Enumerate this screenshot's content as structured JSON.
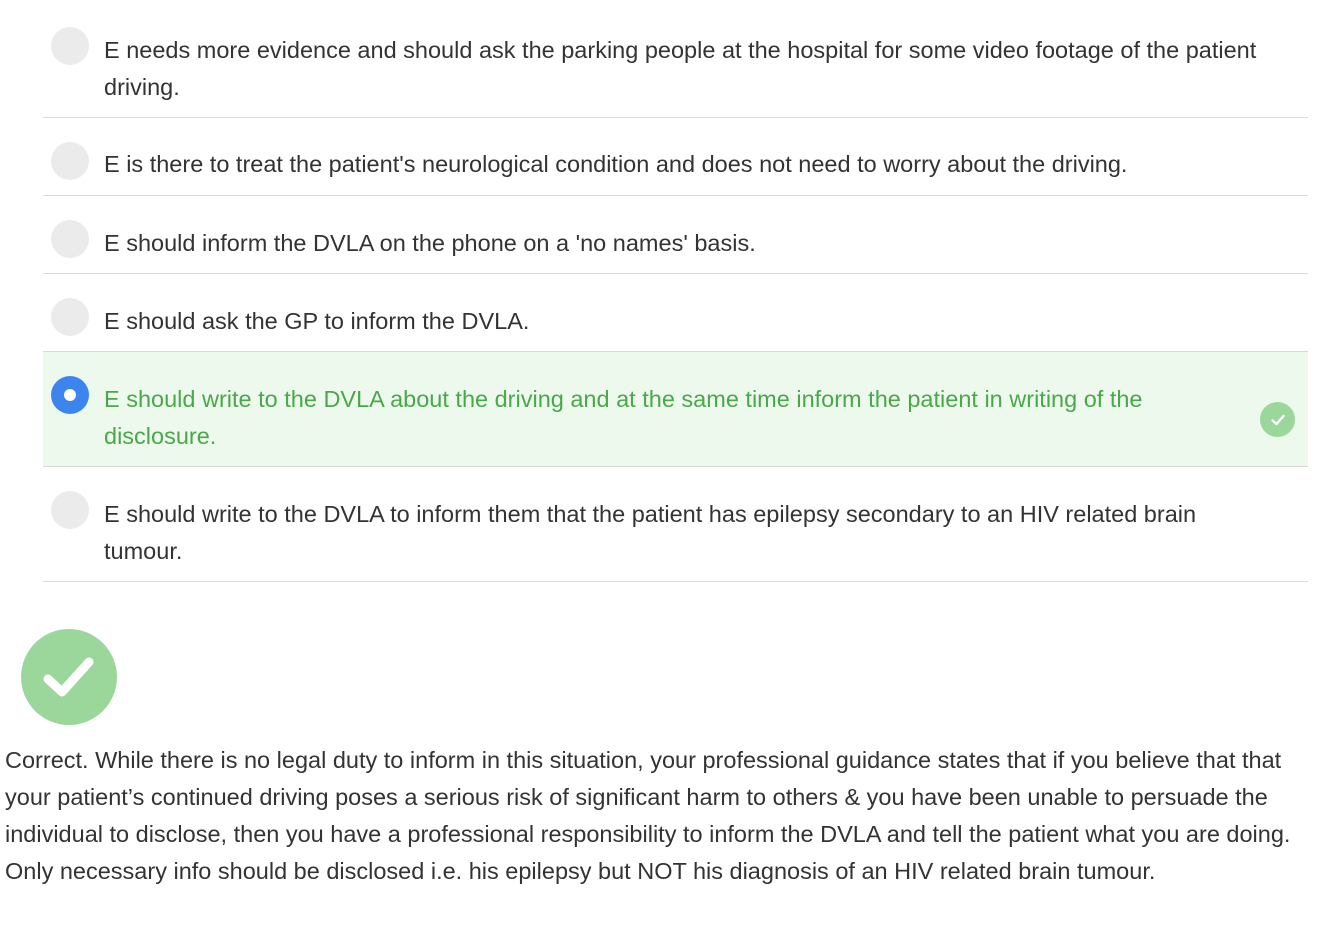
{
  "options": [
    {
      "text": "E needs more evidence and should ask the parking people at the hospital for some video footage of the patient driving.",
      "selected": false
    },
    {
      "text": "E is there to treat the patient's neurological condition and does not need to worry about the driving.",
      "selected": false
    },
    {
      "text": "E should inform the DVLA on the phone on a 'no names' basis.",
      "selected": false
    },
    {
      "text": "E should ask the GP to inform the DVLA.",
      "selected": false
    },
    {
      "text": "E should write to the DVLA about the driving and at the same time inform the patient in writing of the disclosure.",
      "selected": true
    },
    {
      "text": "E should write to the DVLA to inform them that the patient has epilepsy secondary to an HIV related brain tumour.",
      "selected": false
    }
  ],
  "feedback": {
    "icon": "checkmark-icon",
    "text": "Correct. While there is no legal duty to inform in this situation, your professional guidance states that if you believe that that your patient’s continued driving poses a serious risk of significant harm to others & you have been unable to persuade the individual to disclose, then you have a professional responsibility to inform the DVLA and tell the patient what you are doing. Only necessary info should be disclosed i.e. his epilepsy but NOT his diagnosis of an HIV related brain tumour."
  },
  "colors": {
    "correct_text": "#4aa84a",
    "correct_bg": "#edf9ec",
    "correct_icon": "#9bd69b",
    "radio_selected": "#3d85ee",
    "radio_unselected": "#ebebeb"
  }
}
